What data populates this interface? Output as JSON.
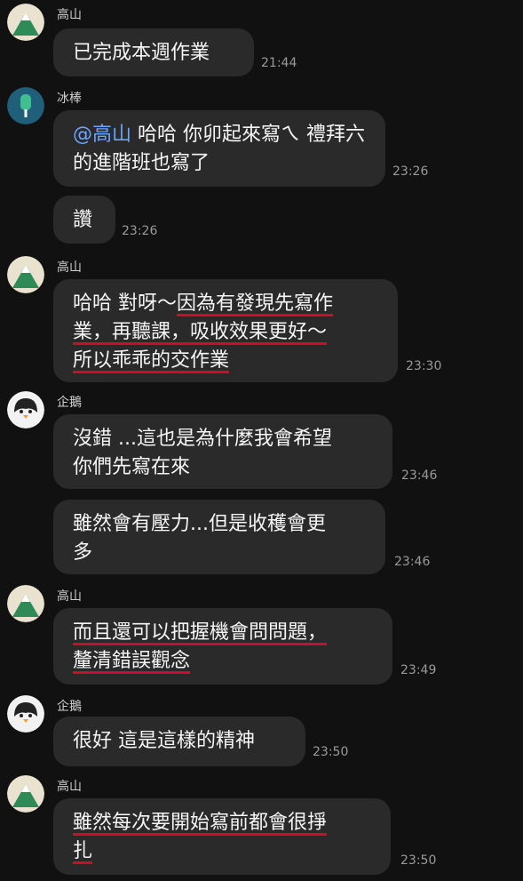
{
  "messages": [
    {
      "sender": "高山",
      "text": "已完成本週作業",
      "time": "21:44"
    },
    {
      "sender": "冰棒",
      "mention": "@高山",
      "text": " 哈哈 你卯起來寫ㄟ 禮拜六的進階班也寫了",
      "time": "23:26"
    },
    {
      "text": "讚",
      "time": "23:26"
    },
    {
      "sender": "高山",
      "line1a": "哈哈 對呀～",
      "line1b": "因為有發現先寫作",
      "line2": "業，再聽課，吸收效果更好～",
      "line3": "所以乖乖的交作業",
      "time": "23:30"
    },
    {
      "sender": "企鵝",
      "line1": "沒錯 ...這也是為什麼我會希望",
      "line2": "你們先寫在來",
      "time": "23:46"
    },
    {
      "line1": "雖然會有壓力...但是收穫會更",
      "line2": "多",
      "time": "23:46"
    },
    {
      "sender": "高山",
      "line1": "而且還可以把握機會問問題，",
      "line2": "釐清錯誤觀念",
      "time": "23:49"
    },
    {
      "sender": "企鵝",
      "text": "很好 這是這樣的精神",
      "time": "23:50"
    },
    {
      "sender": "高山",
      "line1": "雖然每次要開始寫前都會很掙",
      "line2": "扎",
      "time": "23:50"
    }
  ],
  "colors": {
    "background": "#111111",
    "bubble": "#2a2a2a",
    "mention": "#6ea3ff",
    "underline": "#c8102e"
  }
}
